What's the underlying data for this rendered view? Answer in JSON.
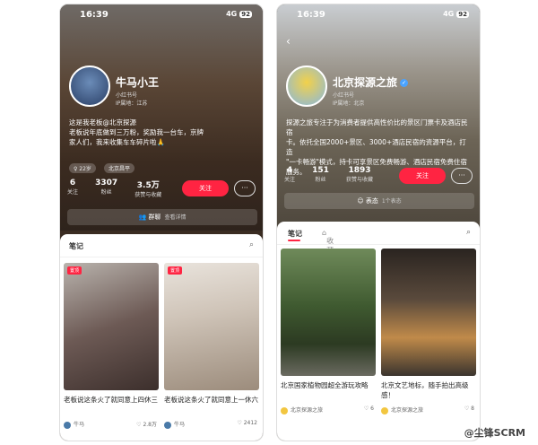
{
  "left": {
    "status": {
      "time": "16:39",
      "signal": "4G",
      "battery": "92"
    },
    "profile": {
      "name": "牛马小王",
      "meta1": "小红书号",
      "meta2": "IP属地：江苏",
      "bio": [
        "这是我老板@北京探源",
        "老板说年底做到三万粉，奖励我一台车，京牌",
        "家人们，我来收集车车碎片啦🙏"
      ],
      "tags": [
        "♀ 22岁",
        "北京昌平"
      ],
      "stats": [
        {
          "value": "6",
          "label": "关注"
        },
        {
          "value": "3307",
          "label": "粉丝"
        },
        {
          "value": "3.5万",
          "label": "获赞与收藏"
        }
      ],
      "follow": "关注",
      "group": {
        "label": "群聊",
        "sub": "查看详情"
      }
    },
    "tabs": {
      "notes": "笔记"
    },
    "cards": [
      {
        "badge": "置顶",
        "title": "老板说这条火了就同意上四休三",
        "author": "牛马",
        "likes": "2.8万"
      },
      {
        "badge": "置顶",
        "title": "老板说这条火了就同意上一休六",
        "author": "牛马",
        "likes": "2412"
      }
    ]
  },
  "right": {
    "status": {
      "time": "16:39",
      "signal": "4G",
      "battery": "92"
    },
    "profile": {
      "name": "北京探源之旅",
      "meta1": "小红书号",
      "meta2": "IP属地：北京",
      "bio": [
        "探源之旅专注于为消费者提供高性价比的景区门票卡及酒店民宿",
        "卡。依托全国2000+景区、3000+酒店民宿的资源平台，打造",
        "\"一卡畅游\"模式，持卡可享景区免费畅游、酒店民宿免费住宿",
        "服务。"
      ],
      "stats": [
        {
          "value": "4",
          "label": "关注"
        },
        {
          "value": "151",
          "label": "粉丝"
        },
        {
          "value": "1893",
          "label": "获赞与收藏"
        }
      ],
      "follow": "关注",
      "group": {
        "label": "表态",
        "sub": "1个表态"
      }
    },
    "tabs": {
      "notes": "笔记",
      "collect": "收藏"
    },
    "cards": [
      {
        "title": "北京国家植物园超全游玩攻略",
        "author": "北京探源之旅",
        "likes": "6"
      },
      {
        "title": "北京文艺地标，随手拍出高级感！",
        "author": "北京探源之旅",
        "likes": "8"
      }
    ],
    "watermark": "@尘锋SCRM"
  }
}
